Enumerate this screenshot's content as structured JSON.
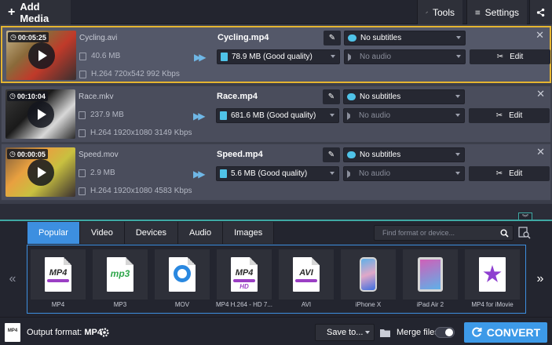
{
  "topbar": {
    "add_media": "Add Media",
    "tools": "Tools",
    "settings": "Settings"
  },
  "files": [
    {
      "duration": "00:05:25",
      "source_name": "Cycling.avi",
      "source_size": "40.6 MB",
      "source_info": "H.264 720x542 992 Kbps",
      "output_name": "Cycling.mp4",
      "quality": "78.9 MB (Good quality)",
      "subtitles": "No subtitles",
      "audio": "No audio",
      "edit": "Edit"
    },
    {
      "duration": "00:10:04",
      "source_name": "Race.mkv",
      "source_size": "237.9 MB",
      "source_info": "H.264 1920x1080 3149 Kbps",
      "output_name": "Race.mp4",
      "quality": "681.6 MB (Good quality)",
      "subtitles": "No subtitles",
      "audio": "No audio",
      "edit": "Edit"
    },
    {
      "duration": "00:00:05",
      "source_name": "Speed.mov",
      "source_size": "2.9 MB",
      "source_info": "H.264 1920x1080 4583 Kbps",
      "output_name": "Speed.mp4",
      "quality": "5.6 MB (Good quality)",
      "subtitles": "No subtitles",
      "audio": "No audio",
      "edit": "Edit"
    }
  ],
  "tabs": [
    "Popular",
    "Video",
    "Devices",
    "Audio",
    "Images"
  ],
  "search": {
    "placeholder": "Find format or device..."
  },
  "formats": [
    {
      "label": "MP4",
      "icon": "MP4"
    },
    {
      "label": "MP3",
      "icon": "mp3"
    },
    {
      "label": "MOV",
      "icon": "quicktime"
    },
    {
      "label": "MP4 H.264 - HD 7...",
      "icon": "MP4",
      "sub": "HD"
    },
    {
      "label": "AVI",
      "icon": "AVI"
    },
    {
      "label": "iPhone X",
      "icon": "iphone"
    },
    {
      "label": "iPad Air 2",
      "icon": "ipad"
    },
    {
      "label": "MP4 for iMovie",
      "icon": "imovie"
    }
  ],
  "bottom": {
    "output_label": "Output format:",
    "output_value": "MP4",
    "output_icon": "MP4",
    "save_to": "Save to...",
    "merge_files": "Merge files:",
    "convert": "CONVERT"
  }
}
